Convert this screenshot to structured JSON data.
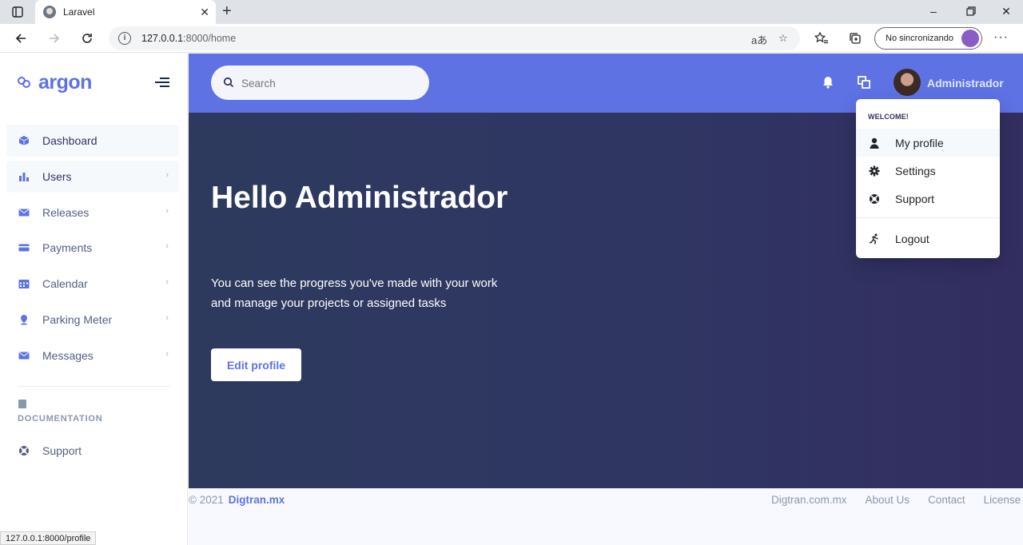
{
  "browser": {
    "tab_title": "Laravel",
    "url_host": "127.0.0.1",
    "url_rest": ":8000/home",
    "read_aloud_icon": "aあ",
    "sync_label": "No sincronizando",
    "status_url": "127.0.0.1:8000/profile"
  },
  "sidebar": {
    "brand": "argon",
    "items": [
      {
        "label": "Dashboard",
        "icon": "cube-icon"
      },
      {
        "label": "Users",
        "icon": "chart-bars-icon"
      },
      {
        "label": "Releases",
        "icon": "envelope-icon"
      },
      {
        "label": "Payments",
        "icon": "credit-card-icon"
      },
      {
        "label": "Calendar",
        "icon": "calendar-icon"
      },
      {
        "label": "Parking Meter",
        "icon": "pin-icon"
      },
      {
        "label": "Messages",
        "icon": "envelope-icon"
      }
    ],
    "doc_heading": "DOCUMENTATION",
    "support_label": "Support"
  },
  "topnav": {
    "search_placeholder": "Search",
    "user_name": "Administrador"
  },
  "hero": {
    "title": "Hello Administrador",
    "text": "You can see the progress you've made with your work and manage your projects or assigned tasks",
    "button": "Edit profile"
  },
  "dropdown": {
    "heading": "WELCOME!",
    "items": [
      {
        "label": "My profile",
        "icon": "user-icon"
      },
      {
        "label": "Settings",
        "icon": "gear-icon"
      },
      {
        "label": "Support",
        "icon": "lifebuoy-icon"
      },
      {
        "label": "Logout",
        "icon": "running-icon"
      }
    ]
  },
  "footer": {
    "copyright": "© 2021",
    "brand_link": "Digtran.mx",
    "links": [
      "Digtran.com.mx",
      "About Us",
      "Contact",
      "License"
    ]
  },
  "colors": {
    "primary": "#5e72e4",
    "hero_bg": "#2f3662",
    "text": "#525f7f"
  }
}
